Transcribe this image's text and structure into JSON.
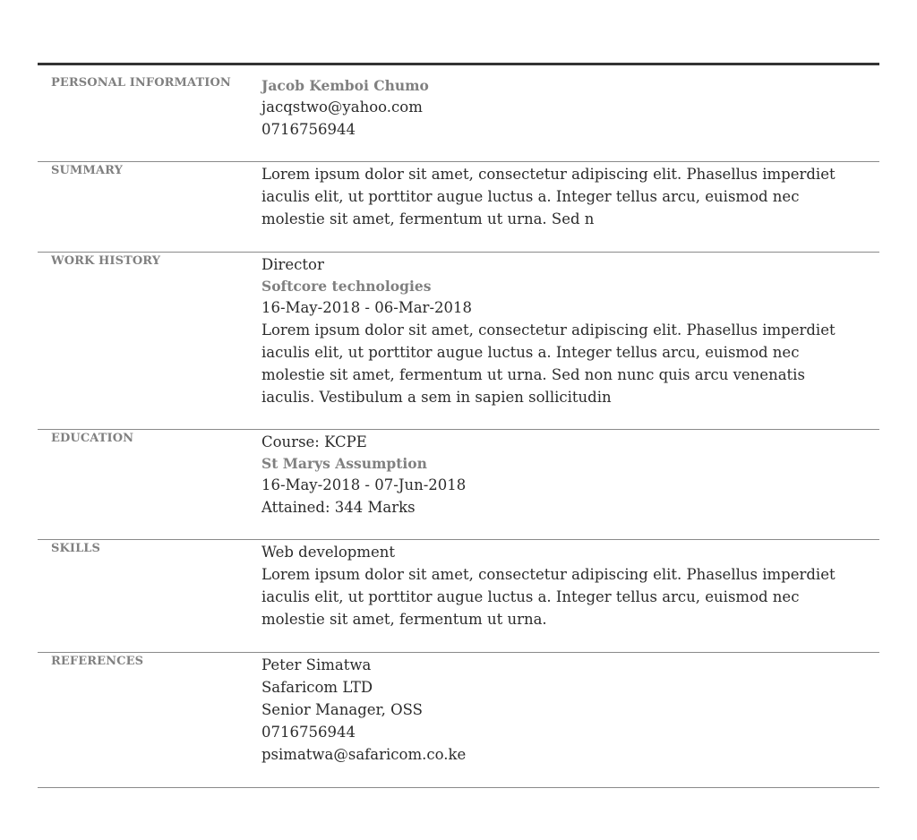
{
  "personal": {
    "label": "PERSONAL INFORMATION",
    "name": "Jacob Kemboi Chumo",
    "email": "jacqstwo@yahoo.com",
    "phone": "0716756944"
  },
  "summary": {
    "label": "SUMMARY",
    "text": "Lorem ipsum dolor sit amet, consectetur adipiscing elit. Phasellus imperdiet iaculis elit, ut porttitor augue luctus a. Integer tellus arcu, euismod nec molestie sit amet, fermentum ut urna. Sed n"
  },
  "work": {
    "label": "WORK HISTORY",
    "title": "Director",
    "company": "Softcore technologies",
    "dates": "16-May-2018 - 06-Mar-2018",
    "description": "Lorem ipsum dolor sit amet, consectetur adipiscing elit. Phasellus imperdiet iaculis elit, ut porttitor augue luctus a. Integer tellus arcu, euismod nec molestie sit amet, fermentum ut urna. Sed non nunc quis arcu venenatis iaculis. Vestibulum a sem in sapien sollicitudin"
  },
  "education": {
    "label": "EDUCATION",
    "course": "Course: KCPE",
    "school": "St Marys Assumption",
    "dates": "16-May-2018 - 07-Jun-2018",
    "attained": "Attained: 344 Marks"
  },
  "skills": {
    "label": "SKILLS",
    "name": "Web development",
    "description": "Lorem ipsum dolor sit amet, consectetur adipiscing elit. Phasellus imperdiet iaculis elit, ut porttitor augue luctus a. Integer tellus arcu, euismod nec molestie sit amet, fermentum ut urna."
  },
  "references": {
    "label": "REFERENCES",
    "name": "Peter Simatwa",
    "company": "Safaricom LTD",
    "position": "Senior Manager, OSS",
    "phone": "0716756944",
    "email": "psimatwa@safaricom.co.ke"
  }
}
